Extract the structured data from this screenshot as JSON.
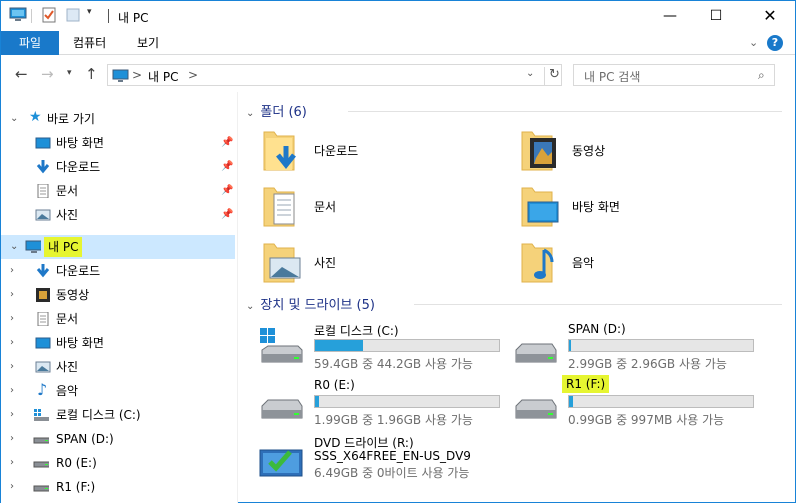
{
  "window": {
    "title": "내 PC"
  },
  "ribbon": {
    "tabs": [
      "파일",
      "컴퓨터",
      "보기"
    ],
    "help": "?"
  },
  "address": {
    "crumb_root": "내 PC",
    "sep": ">"
  },
  "search": {
    "placeholder": "내 PC 검색"
  },
  "nav": {
    "quick_access": "바로 가기",
    "pinned": [
      "바탕 화면",
      "다운로드",
      "문서",
      "사진"
    ],
    "this_pc": "내 PC",
    "pc_children": [
      "다운로드",
      "동영상",
      "문서",
      "바탕 화면",
      "사진",
      "음악",
      "로컬 디스크 (C:)",
      "SPAN (D:)",
      "R0 (E:)",
      "R1 (F:)"
    ]
  },
  "folders": {
    "header": "폴더",
    "count": "(6)",
    "items": [
      "다운로드",
      "동영상",
      "문서",
      "바탕 화면",
      "사진",
      "음악"
    ]
  },
  "devices": {
    "header": "장치 및 드라이브",
    "count": "(5)",
    "drives": [
      {
        "name": "로컬 디스크 (C:)",
        "free": "59.4GB 중 44.2GB 사용 가능",
        "used_fraction": 0.26
      },
      {
        "name": "SPAN (D:)",
        "free": "2.99GB 중 2.96GB 사용 가능",
        "used_fraction": 0.01
      },
      {
        "name": "R0 (E:)",
        "free": "1.99GB 중 1.96GB 사용 가능",
        "used_fraction": 0.02
      },
      {
        "name": "R1 (F:)",
        "free": "0.99GB 중 997MB 사용 가능",
        "used_fraction": 0.02
      }
    ],
    "dvd": {
      "name": "DVD 드라이브 (R:)",
      "label": "SSS_X64FREE_EN-US_DV9",
      "free": "6.49GB 중 0바이트 사용 가능"
    }
  },
  "colors": {
    "accent": "#1979ca",
    "highlight": "#e6f531",
    "selection": "#cce8ff",
    "bar": "#26a0da"
  }
}
